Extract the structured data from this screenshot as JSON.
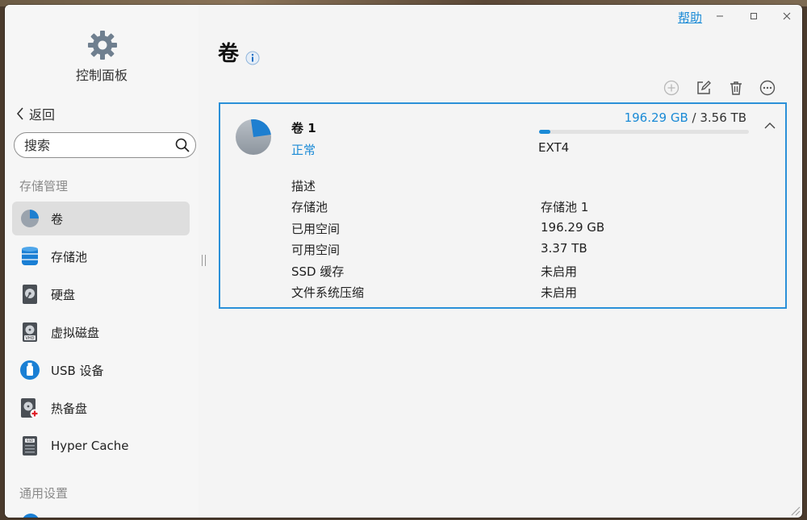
{
  "app": {
    "title": "控制面板",
    "help_label": "帮助"
  },
  "sidebar": {
    "back_label": "返回",
    "search": {
      "placeholder": "搜索",
      "value": ""
    },
    "section_storage": "存储管理",
    "section_general": "通用设置",
    "items": [
      {
        "label": "卷",
        "icon": "volume-pie-icon",
        "active": true
      },
      {
        "label": "存储池",
        "icon": "storage-pool-icon"
      },
      {
        "label": "硬盘",
        "icon": "hard-disk-icon"
      },
      {
        "label": "虚拟磁盘",
        "icon": "virtual-disk-icon"
      },
      {
        "label": "USB 设备",
        "icon": "usb-device-icon"
      },
      {
        "label": "热备盘",
        "icon": "hot-spare-disk-icon"
      },
      {
        "label": "Hyper Cache",
        "icon": "hyper-cache-icon"
      }
    ]
  },
  "main": {
    "title": "卷",
    "toolbar": [
      "add-icon",
      "edit-icon",
      "delete-icon",
      "more-icon"
    ],
    "volume": {
      "name": "卷 1",
      "status": "正常",
      "used": "196.29 GB",
      "separator": "/",
      "total": "3.56 TB",
      "usage_fraction": 0.054,
      "filesystem": "EXT4",
      "details": [
        {
          "label": "描述",
          "value": ""
        },
        {
          "label": "存储池",
          "value": "存储池 1"
        },
        {
          "label": "已用空间",
          "value": "196.29 GB"
        },
        {
          "label": "可用空间",
          "value": "3.37 TB"
        },
        {
          "label": "SSD 缓存",
          "value": "未启用"
        },
        {
          "label": "文件系统压缩",
          "value": "未启用"
        }
      ]
    }
  },
  "colors": {
    "accent": "#1a8ad6",
    "selection": "#dedede",
    "card_border": "#2a90d8"
  }
}
